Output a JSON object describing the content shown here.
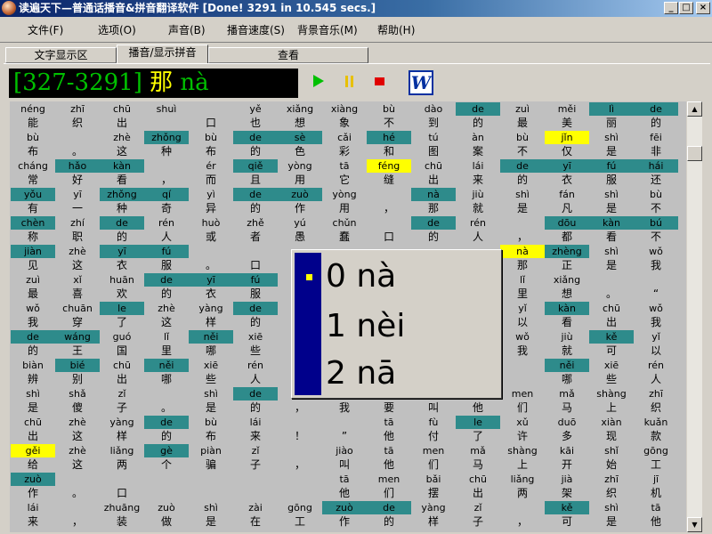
{
  "window": {
    "title": "读遍天下—普通话播音&拼音翻译软件 [Done! 3291 in 10.545 secs.]",
    "min": "_",
    "max": "□",
    "close": "×"
  },
  "menu": [
    "文件(F)",
    "选项(O)",
    "声音(B)",
    "播音速度(S)",
    "背景音乐(M)",
    "帮助(H)"
  ],
  "tabs": [
    "文字显示区",
    "播音/显示拼音",
    "查看"
  ],
  "display": {
    "counter": "[327-3291]",
    "hanzi": "那",
    "pinyin": "nà"
  },
  "toolbar": {
    "word": "W"
  },
  "popup": {
    "options": [
      "0 nà",
      "1 nèi",
      "2 nā"
    ]
  },
  "grid": [
    [
      [
        "néng",
        "能",
        ""
      ],
      [
        "zhī",
        "织",
        ""
      ],
      [
        "chū",
        "出",
        ""
      ],
      [
        "shuì",
        "",
        ""
      ],
      [
        "",
        "口",
        ""
      ],
      [
        "yě",
        "也",
        ""
      ],
      [
        "xiǎng",
        "想",
        ""
      ],
      [
        "xiàng",
        "象",
        ""
      ],
      [
        "bù",
        "不",
        ""
      ],
      [
        "dào",
        "到",
        ""
      ],
      [
        "de",
        "的",
        "t"
      ],
      [
        "zuì",
        "最",
        ""
      ],
      [
        "měi",
        "美",
        ""
      ],
      [
        "lì",
        "丽",
        "t"
      ],
      [
        "de",
        "的",
        "t"
      ]
    ],
    [
      [
        "bù",
        "布",
        ""
      ],
      [
        "",
        "。",
        ""
      ],
      [
        "zhè",
        "这",
        ""
      ],
      [
        "zhǒng",
        "种",
        "t"
      ],
      [
        "bù",
        "布",
        ""
      ],
      [
        "de",
        "的",
        "t"
      ],
      [
        "sè",
        "色",
        "t"
      ],
      [
        "cǎi",
        "彩",
        ""
      ],
      [
        "hé",
        "和",
        "t"
      ],
      [
        "tú",
        "图",
        ""
      ],
      [
        "àn",
        "案",
        ""
      ],
      [
        "bù",
        "不",
        ""
      ],
      [
        "jǐn",
        "仅",
        "y"
      ],
      [
        "shì",
        "是",
        ""
      ],
      [
        "fēi",
        "非",
        ""
      ]
    ],
    [
      [
        "cháng",
        "常",
        ""
      ],
      [
        "hǎo",
        "好",
        "t"
      ],
      [
        "kàn",
        "看",
        "t"
      ],
      [
        "",
        "，",
        ""
      ],
      [
        "ér",
        "而",
        ""
      ],
      [
        "qiě",
        "且",
        "t"
      ],
      [
        "yòng",
        "用",
        ""
      ],
      [
        "tā",
        "它",
        ""
      ],
      [
        "féng",
        "缝",
        "y"
      ],
      [
        "chū",
        "出",
        ""
      ],
      [
        "lái",
        "来",
        ""
      ],
      [
        "de",
        "的",
        "t"
      ],
      [
        "yī",
        "衣",
        "t"
      ],
      [
        "fú",
        "服",
        "t"
      ],
      [
        "hái",
        "还",
        "t"
      ]
    ],
    [
      [
        "yǒu",
        "有",
        "t"
      ],
      [
        "yī",
        "一",
        ""
      ],
      [
        "zhǒng",
        "种",
        "t"
      ],
      [
        "qí",
        "奇",
        "t"
      ],
      [
        "yì",
        "异",
        ""
      ],
      [
        "de",
        "的",
        "t"
      ],
      [
        "zuò",
        "作",
        "t"
      ],
      [
        "yòng",
        "用",
        ""
      ],
      [
        "",
        "，",
        ""
      ],
      [
        "nà",
        "那",
        "t"
      ],
      [
        "jiù",
        "就",
        ""
      ],
      [
        "shì",
        "是",
        ""
      ],
      [
        "fán",
        "凡",
        ""
      ],
      [
        "shì",
        "是",
        ""
      ],
      [
        "bù",
        "不",
        ""
      ]
    ],
    [
      [
        "chèn",
        "称",
        "t"
      ],
      [
        "zhí",
        "职",
        ""
      ],
      [
        "de",
        "的",
        "t"
      ],
      [
        "rén",
        "人",
        ""
      ],
      [
        "huò",
        "或",
        ""
      ],
      [
        "zhě",
        "者",
        ""
      ],
      [
        "yú",
        "愚",
        ""
      ],
      [
        "chǔn",
        "蠢",
        ""
      ],
      [
        "",
        "口",
        ""
      ],
      [
        "de",
        "的",
        "t"
      ],
      [
        "rén",
        "人",
        ""
      ],
      [
        "",
        "，",
        ""
      ],
      [
        "dōu",
        "都",
        "t"
      ],
      [
        "kàn",
        "看",
        "t"
      ],
      [
        "bú",
        "不",
        "t"
      ]
    ],
    [
      [
        "jiàn",
        "见",
        "t"
      ],
      [
        "zhè",
        "这",
        ""
      ],
      [
        "yī",
        "衣",
        "t"
      ],
      [
        "fú",
        "服",
        "t"
      ],
      [
        "",
        "。",
        ""
      ],
      [
        "",
        "口",
        ""
      ],
      [
        "",
        "",
        ""
      ],
      [
        "",
        "",
        ""
      ],
      [
        "",
        "",
        ""
      ],
      [
        "",
        "",
        ""
      ],
      [
        "",
        "",
        ""
      ],
      [
        "nà",
        "那",
        "y"
      ],
      [
        "zhèng",
        "正",
        "t"
      ],
      [
        "shì",
        "是",
        ""
      ],
      [
        "wǒ",
        "我",
        ""
      ]
    ],
    [
      [
        "zuì",
        "最",
        ""
      ],
      [
        "xǐ",
        "喜",
        ""
      ],
      [
        "huān",
        "欢",
        ""
      ],
      [
        "de",
        "的",
        "t"
      ],
      [
        "yī",
        "衣",
        "t"
      ],
      [
        "fú",
        "服",
        "t"
      ],
      [
        "",
        "",
        ""
      ],
      [
        "",
        "",
        ""
      ],
      [
        "",
        "",
        ""
      ],
      [
        "",
        "",
        ""
      ],
      [
        "",
        "",
        ""
      ],
      [
        "lǐ",
        "里",
        ""
      ],
      [
        "xiǎng",
        "想",
        ""
      ],
      [
        "",
        "。",
        ""
      ],
      [
        "",
        "“",
        ""
      ]
    ],
    [
      [
        "wǒ",
        "我",
        ""
      ],
      [
        "chuān",
        "穿",
        ""
      ],
      [
        "le",
        "了",
        "t"
      ],
      [
        "zhè",
        "这",
        ""
      ],
      [
        "yàng",
        "样",
        ""
      ],
      [
        "de",
        "的",
        "t"
      ],
      [
        "",
        "",
        ""
      ],
      [
        "",
        "",
        ""
      ],
      [
        "",
        "",
        ""
      ],
      [
        "",
        "",
        ""
      ],
      [
        "",
        "",
        ""
      ],
      [
        "yǐ",
        "以",
        ""
      ],
      [
        "kàn",
        "看",
        "t"
      ],
      [
        "chū",
        "出",
        ""
      ],
      [
        "wǒ",
        "我",
        ""
      ]
    ],
    [
      [
        "de",
        "的",
        "t"
      ],
      [
        "wáng",
        "王",
        "t"
      ],
      [
        "guó",
        "国",
        ""
      ],
      [
        "lǐ",
        "里",
        ""
      ],
      [
        "něi",
        "哪",
        "t"
      ],
      [
        "xiē",
        "些",
        ""
      ],
      [
        "",
        "",
        ""
      ],
      [
        "",
        "",
        ""
      ],
      [
        "",
        "",
        ""
      ],
      [
        "",
        "",
        ""
      ],
      [
        "",
        "",
        ""
      ],
      [
        "wǒ",
        "我",
        ""
      ],
      [
        "jiù",
        "就",
        ""
      ],
      [
        "kě",
        "可",
        "t"
      ],
      [
        "yǐ",
        "以",
        ""
      ]
    ],
    [
      [
        "biàn",
        "辨",
        ""
      ],
      [
        "bié",
        "别",
        "t"
      ],
      [
        "chū",
        "出",
        ""
      ],
      [
        "něi",
        "哪",
        "t"
      ],
      [
        "xiē",
        "些",
        ""
      ],
      [
        "rén",
        "人",
        ""
      ],
      [
        "",
        "",
        ""
      ],
      [
        "",
        "",
        ""
      ],
      [
        "",
        "",
        ""
      ],
      [
        "",
        "",
        ""
      ],
      [
        "",
        "口",
        ""
      ],
      [
        "",
        "",
        ""
      ],
      [
        "něi",
        "哪",
        "t"
      ],
      [
        "xiē",
        "些",
        ""
      ],
      [
        "rén",
        "人",
        ""
      ]
    ],
    [
      [
        "shì",
        "是",
        ""
      ],
      [
        "shǎ",
        "傻",
        ""
      ],
      [
        "zǐ",
        "子",
        ""
      ],
      [
        "",
        "。",
        ""
      ],
      [
        "shì",
        "是",
        ""
      ],
      [
        "de",
        "的",
        "t"
      ],
      [
        "",
        "，",
        ""
      ],
      [
        "",
        "我",
        ""
      ],
      [
        "",
        "要",
        ""
      ],
      [
        "",
        "叫",
        ""
      ],
      [
        "",
        "他",
        ""
      ],
      [
        "men",
        "们",
        ""
      ],
      [
        "mǎ",
        "马",
        ""
      ],
      [
        "shàng",
        "上",
        ""
      ],
      [
        "zhī",
        "织",
        ""
      ]
    ],
    [
      [
        "chū",
        "出",
        ""
      ],
      [
        "zhè",
        "这",
        ""
      ],
      [
        "yàng",
        "样",
        ""
      ],
      [
        "de",
        "的",
        "t"
      ],
      [
        "bù",
        "布",
        ""
      ],
      [
        "lái",
        "来",
        ""
      ],
      [
        "",
        "！",
        ""
      ],
      [
        "",
        "”",
        ""
      ],
      [
        "tā",
        "他",
        ""
      ],
      [
        "fù",
        "付",
        ""
      ],
      [
        "le",
        "了",
        "t"
      ],
      [
        "xǔ",
        "许",
        ""
      ],
      [
        "duō",
        "多",
        ""
      ],
      [
        "xiàn",
        "现",
        ""
      ],
      [
        "kuǎn",
        "款",
        ""
      ]
    ],
    [
      [
        "gěi",
        "给",
        "y"
      ],
      [
        "zhè",
        "这",
        ""
      ],
      [
        "liǎng",
        "两",
        ""
      ],
      [
        "gè",
        "个",
        "t"
      ],
      [
        "piàn",
        "骗",
        ""
      ],
      [
        "zǐ",
        "子",
        ""
      ],
      [
        "",
        "，",
        ""
      ],
      [
        "jiào",
        "叫",
        ""
      ],
      [
        "tā",
        "他",
        ""
      ],
      [
        "men",
        "们",
        ""
      ],
      [
        "mǎ",
        "马",
        ""
      ],
      [
        "shàng",
        "上",
        ""
      ],
      [
        "kāi",
        "开",
        ""
      ],
      [
        "shǐ",
        "始",
        ""
      ],
      [
        "gōng",
        "工",
        ""
      ]
    ],
    [
      [
        "zuò",
        "作",
        "t"
      ],
      [
        "",
        "。",
        ""
      ],
      [
        "",
        "口",
        ""
      ],
      [
        "",
        "",
        ""
      ],
      [
        "",
        "",
        ""
      ],
      [
        "",
        "",
        ""
      ],
      [
        "",
        "",
        ""
      ],
      [
        "tā",
        "他",
        ""
      ],
      [
        "men",
        "们",
        ""
      ],
      [
        "bǎi",
        "摆",
        ""
      ],
      [
        "chū",
        "出",
        ""
      ],
      [
        "liǎng",
        "两",
        ""
      ],
      [
        "jià",
        "架",
        ""
      ],
      [
        "zhī",
        "织",
        ""
      ],
      [
        "jī",
        "机",
        ""
      ]
    ],
    [
      [
        "lái",
        "来",
        ""
      ],
      [
        "",
        "，",
        ""
      ],
      [
        "zhuāng",
        "装",
        ""
      ],
      [
        "zuò",
        "做",
        ""
      ],
      [
        "shì",
        "是",
        ""
      ],
      [
        "zài",
        "在",
        ""
      ],
      [
        "gōng",
        "工",
        ""
      ],
      [
        "zuò",
        "作",
        "t"
      ],
      [
        "de",
        "的",
        "t"
      ],
      [
        "yàng",
        "样",
        ""
      ],
      [
        "zǐ",
        "子",
        ""
      ],
      [
        "",
        "，",
        ""
      ],
      [
        "kě",
        "可",
        "t"
      ],
      [
        "shì",
        "是",
        ""
      ],
      [
        "tā",
        "他",
        ""
      ]
    ]
  ]
}
